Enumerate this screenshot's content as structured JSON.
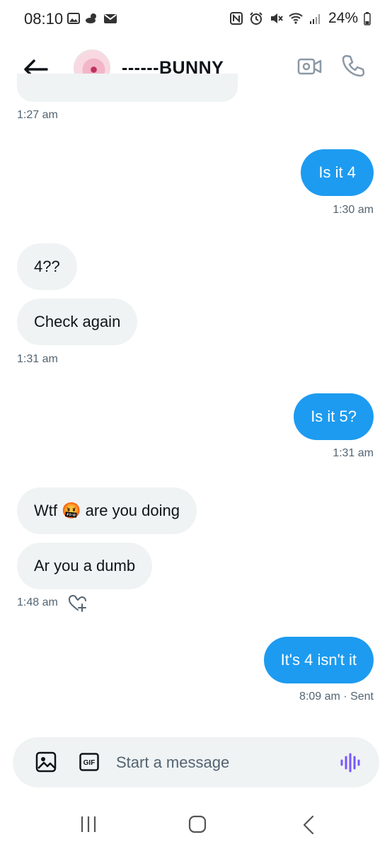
{
  "status_bar": {
    "time": "08:10",
    "battery": "24%"
  },
  "header": {
    "title": "------BUNNY"
  },
  "messages": [
    {
      "dir": "in",
      "text": "4??"
    },
    {
      "dir": "in",
      "text": "Check again"
    },
    {
      "dir": "out",
      "text": "Is it 4"
    },
    {
      "dir": "out",
      "text": "Is it 5?"
    },
    {
      "dir": "in",
      "text": "Wtf",
      "emoji": "🤬",
      "text_after": "are you doing"
    },
    {
      "dir": "in",
      "text": "Ar you a dumb"
    },
    {
      "dir": "out",
      "text": "It's 4 isn't it"
    }
  ],
  "timestamps": {
    "t1": "1:27 am",
    "t2": "1:30 am",
    "t3": "1:31 am",
    "t4": "1:31 am",
    "t5": "1:48 am",
    "t6": "8:09 am · Sent"
  },
  "composer": {
    "placeholder": "Start a message",
    "gif_label": "GIF"
  },
  "colors": {
    "accent": "#1d9bf0",
    "incoming_bubble": "#eff3f4",
    "voice_icon": "#7856ff"
  },
  "icons": [
    "back-arrow-icon",
    "video-call-icon",
    "phone-icon",
    "add-reaction-icon",
    "image-icon",
    "gif-icon",
    "voice-icon",
    "recent-apps-icon",
    "home-icon",
    "back-nav-icon"
  ]
}
